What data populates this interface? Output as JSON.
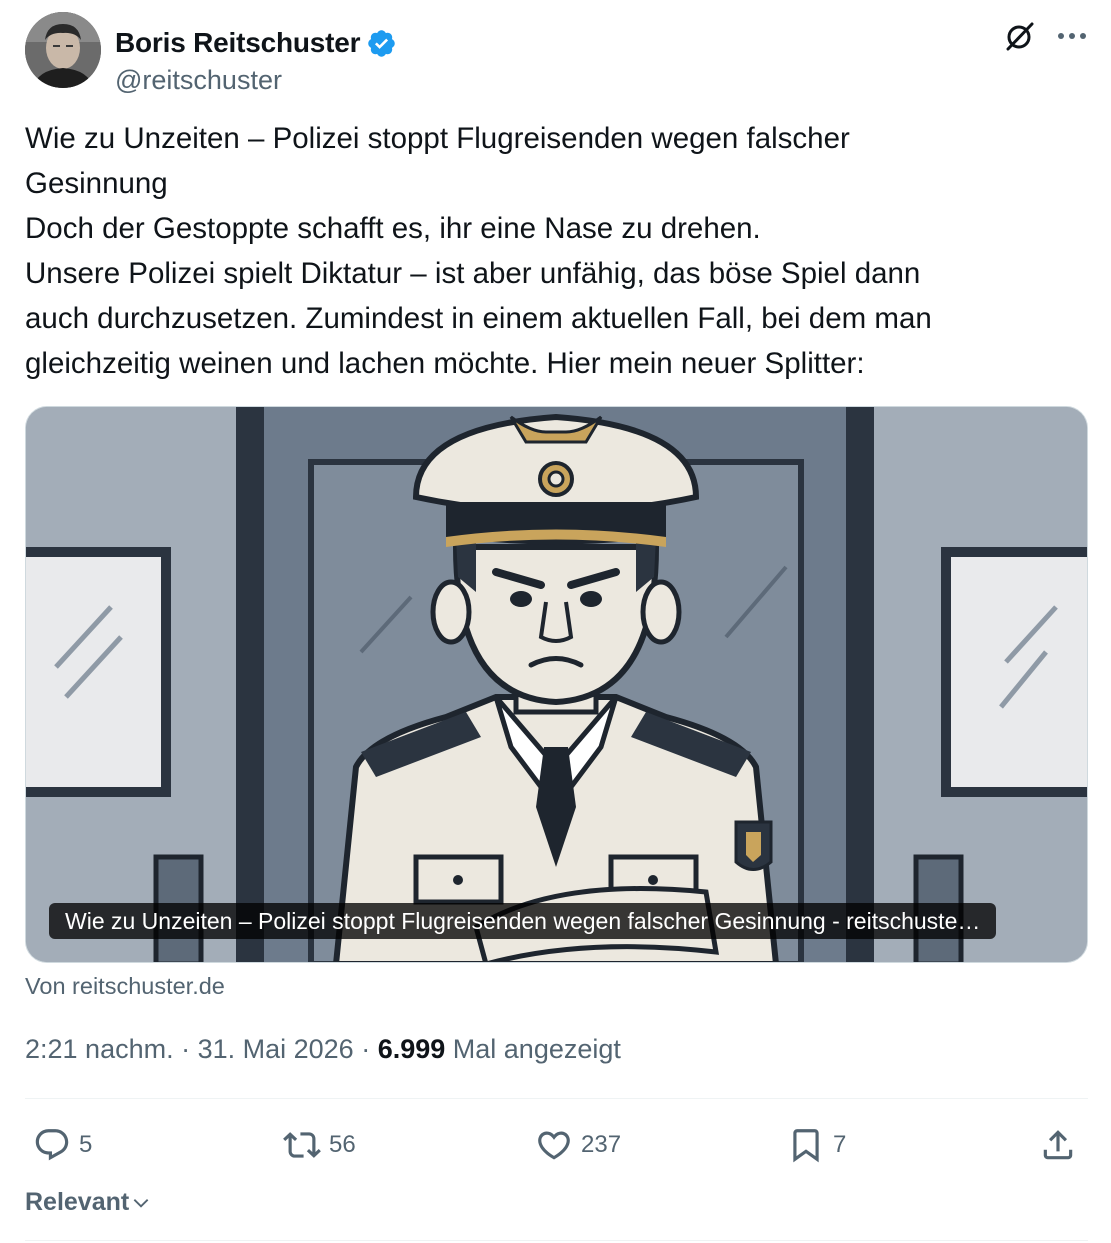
{
  "author": {
    "display_name": "Boris Reitschuster",
    "handle": "@reitschuster",
    "verified": true
  },
  "icons": {
    "avatar": "avatar-photo",
    "verified": "verified-badge-icon",
    "grok": "grok-icon",
    "more": "more-icon",
    "reply": "reply-icon",
    "retweet": "retweet-icon",
    "like": "heart-icon",
    "bookmark": "bookmark-icon",
    "share": "share-icon",
    "chevron": "chevron-down-icon"
  },
  "tweet": {
    "lines": [
      "Wie zu Unzeiten – Polizei stoppt Flugreisenden wegen falscher",
      "Gesinnung",
      "Doch der Gestoppte schafft es, ihr eine Nase zu drehen.",
      "Unsere Polizei spielt Diktatur – ist aber unfähig, das böse Spiel dann",
      "auch durchzusetzen. Zumindest in einem aktuellen Fall, bei dem man",
      "gleichzeitig weinen und lachen möchte. Hier mein neuer Splitter:"
    ]
  },
  "card": {
    "caption": "Wie zu Unzeiten – Polizei stoppt Flugreisenden wegen falscher Gesinnung - reitschuste…",
    "source": "Von reitschuster.de"
  },
  "meta": {
    "time": "2:21 nachm.",
    "separator": " · ",
    "date": "31. Mai 2026",
    "views_count": "6.999",
    "views_label": " Mal angezeigt"
  },
  "actions": {
    "replies": "5",
    "retweets": "56",
    "likes": "237",
    "bookmarks": "7"
  },
  "sort": {
    "label": "Relevant"
  },
  "colors": {
    "text": "#0f1419",
    "secondary": "#536471",
    "verified_blue": "#1d9bf0",
    "divider": "#eff3f4"
  }
}
